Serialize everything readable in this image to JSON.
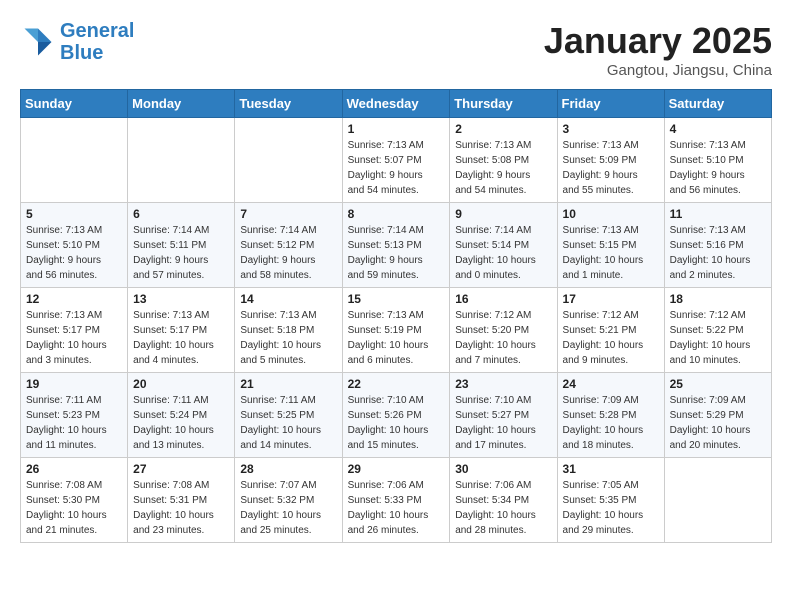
{
  "header": {
    "logo_line1": "General",
    "logo_line2": "Blue",
    "month": "January 2025",
    "location": "Gangtou, Jiangsu, China"
  },
  "weekdays": [
    "Sunday",
    "Monday",
    "Tuesday",
    "Wednesday",
    "Thursday",
    "Friday",
    "Saturday"
  ],
  "weeks": [
    [
      {
        "day": "",
        "info": ""
      },
      {
        "day": "",
        "info": ""
      },
      {
        "day": "",
        "info": ""
      },
      {
        "day": "1",
        "info": "Sunrise: 7:13 AM\nSunset: 5:07 PM\nDaylight: 9 hours\nand 54 minutes."
      },
      {
        "day": "2",
        "info": "Sunrise: 7:13 AM\nSunset: 5:08 PM\nDaylight: 9 hours\nand 54 minutes."
      },
      {
        "day": "3",
        "info": "Sunrise: 7:13 AM\nSunset: 5:09 PM\nDaylight: 9 hours\nand 55 minutes."
      },
      {
        "day": "4",
        "info": "Sunrise: 7:13 AM\nSunset: 5:10 PM\nDaylight: 9 hours\nand 56 minutes."
      }
    ],
    [
      {
        "day": "5",
        "info": "Sunrise: 7:13 AM\nSunset: 5:10 PM\nDaylight: 9 hours\nand 56 minutes."
      },
      {
        "day": "6",
        "info": "Sunrise: 7:14 AM\nSunset: 5:11 PM\nDaylight: 9 hours\nand 57 minutes."
      },
      {
        "day": "7",
        "info": "Sunrise: 7:14 AM\nSunset: 5:12 PM\nDaylight: 9 hours\nand 58 minutes."
      },
      {
        "day": "8",
        "info": "Sunrise: 7:14 AM\nSunset: 5:13 PM\nDaylight: 9 hours\nand 59 minutes."
      },
      {
        "day": "9",
        "info": "Sunrise: 7:14 AM\nSunset: 5:14 PM\nDaylight: 10 hours\nand 0 minutes."
      },
      {
        "day": "10",
        "info": "Sunrise: 7:13 AM\nSunset: 5:15 PM\nDaylight: 10 hours\nand 1 minute."
      },
      {
        "day": "11",
        "info": "Sunrise: 7:13 AM\nSunset: 5:16 PM\nDaylight: 10 hours\nand 2 minutes."
      }
    ],
    [
      {
        "day": "12",
        "info": "Sunrise: 7:13 AM\nSunset: 5:17 PM\nDaylight: 10 hours\nand 3 minutes."
      },
      {
        "day": "13",
        "info": "Sunrise: 7:13 AM\nSunset: 5:17 PM\nDaylight: 10 hours\nand 4 minutes."
      },
      {
        "day": "14",
        "info": "Sunrise: 7:13 AM\nSunset: 5:18 PM\nDaylight: 10 hours\nand 5 minutes."
      },
      {
        "day": "15",
        "info": "Sunrise: 7:13 AM\nSunset: 5:19 PM\nDaylight: 10 hours\nand 6 minutes."
      },
      {
        "day": "16",
        "info": "Sunrise: 7:12 AM\nSunset: 5:20 PM\nDaylight: 10 hours\nand 7 minutes."
      },
      {
        "day": "17",
        "info": "Sunrise: 7:12 AM\nSunset: 5:21 PM\nDaylight: 10 hours\nand 9 minutes."
      },
      {
        "day": "18",
        "info": "Sunrise: 7:12 AM\nSunset: 5:22 PM\nDaylight: 10 hours\nand 10 minutes."
      }
    ],
    [
      {
        "day": "19",
        "info": "Sunrise: 7:11 AM\nSunset: 5:23 PM\nDaylight: 10 hours\nand 11 minutes."
      },
      {
        "day": "20",
        "info": "Sunrise: 7:11 AM\nSunset: 5:24 PM\nDaylight: 10 hours\nand 13 minutes."
      },
      {
        "day": "21",
        "info": "Sunrise: 7:11 AM\nSunset: 5:25 PM\nDaylight: 10 hours\nand 14 minutes."
      },
      {
        "day": "22",
        "info": "Sunrise: 7:10 AM\nSunset: 5:26 PM\nDaylight: 10 hours\nand 15 minutes."
      },
      {
        "day": "23",
        "info": "Sunrise: 7:10 AM\nSunset: 5:27 PM\nDaylight: 10 hours\nand 17 minutes."
      },
      {
        "day": "24",
        "info": "Sunrise: 7:09 AM\nSunset: 5:28 PM\nDaylight: 10 hours\nand 18 minutes."
      },
      {
        "day": "25",
        "info": "Sunrise: 7:09 AM\nSunset: 5:29 PM\nDaylight: 10 hours\nand 20 minutes."
      }
    ],
    [
      {
        "day": "26",
        "info": "Sunrise: 7:08 AM\nSunset: 5:30 PM\nDaylight: 10 hours\nand 21 minutes."
      },
      {
        "day": "27",
        "info": "Sunrise: 7:08 AM\nSunset: 5:31 PM\nDaylight: 10 hours\nand 23 minutes."
      },
      {
        "day": "28",
        "info": "Sunrise: 7:07 AM\nSunset: 5:32 PM\nDaylight: 10 hours\nand 25 minutes."
      },
      {
        "day": "29",
        "info": "Sunrise: 7:06 AM\nSunset: 5:33 PM\nDaylight: 10 hours\nand 26 minutes."
      },
      {
        "day": "30",
        "info": "Sunrise: 7:06 AM\nSunset: 5:34 PM\nDaylight: 10 hours\nand 28 minutes."
      },
      {
        "day": "31",
        "info": "Sunrise: 7:05 AM\nSunset: 5:35 PM\nDaylight: 10 hours\nand 29 minutes."
      },
      {
        "day": "",
        "info": ""
      }
    ]
  ]
}
